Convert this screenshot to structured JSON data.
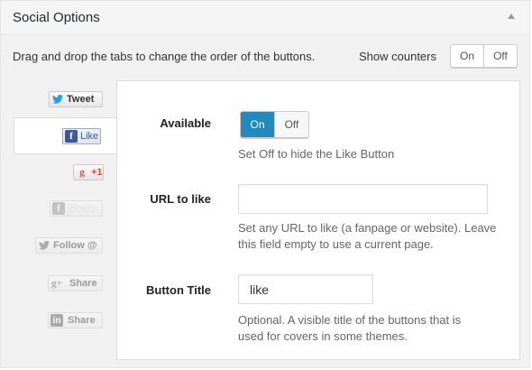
{
  "panel": {
    "title": "Social Options"
  },
  "intro": {
    "description": "Drag and drop the tabs to change the order of the buttons.",
    "counters_label": "Show counters",
    "counters_toggle": {
      "on": "On",
      "off": "Off",
      "selected": "On"
    }
  },
  "tabs": [
    {
      "id": "twitter",
      "label": "Tweet",
      "icon": "twitter-bird-icon",
      "active": false
    },
    {
      "id": "facebook",
      "label": "Like",
      "icon": "facebook-f-icon",
      "active": true
    },
    {
      "id": "googleplus",
      "label": "+1",
      "icon": "google-g-icon",
      "active": false
    },
    {
      "id": "facebook-share",
      "label": "Share",
      "icon": "facebook-f-icon",
      "active": false
    },
    {
      "id": "twitter-follow",
      "label": "Follow @",
      "icon": "twitter-bird-icon",
      "active": false
    },
    {
      "id": "googleplus-share",
      "label": "Share",
      "icon": "google-plus-icon",
      "active": false
    },
    {
      "id": "linkedin-share",
      "label": "Share",
      "icon": "linkedin-icon",
      "active": false
    }
  ],
  "settings": {
    "available": {
      "label": "Available",
      "on": "On",
      "off": "Off",
      "selected": "On",
      "help": "Set Off to hide the Like Button"
    },
    "url": {
      "label": "URL to like",
      "value": "",
      "help_line1": "Set any URL to like (a fanpage or website). Leave",
      "help_line2": "this field empty to use a current page."
    },
    "button_title": {
      "label": "Button Title",
      "value": "like",
      "help_line1": "Optional. A visible title of the buttons that is",
      "help_line2": "used for covers in some themes."
    }
  },
  "colors": {
    "toggle_active": "#1e8cbe",
    "twitter": "#1da1f2",
    "facebook": "#3b5998",
    "google": "#dd4b39",
    "linkedin": "#0077b5"
  }
}
